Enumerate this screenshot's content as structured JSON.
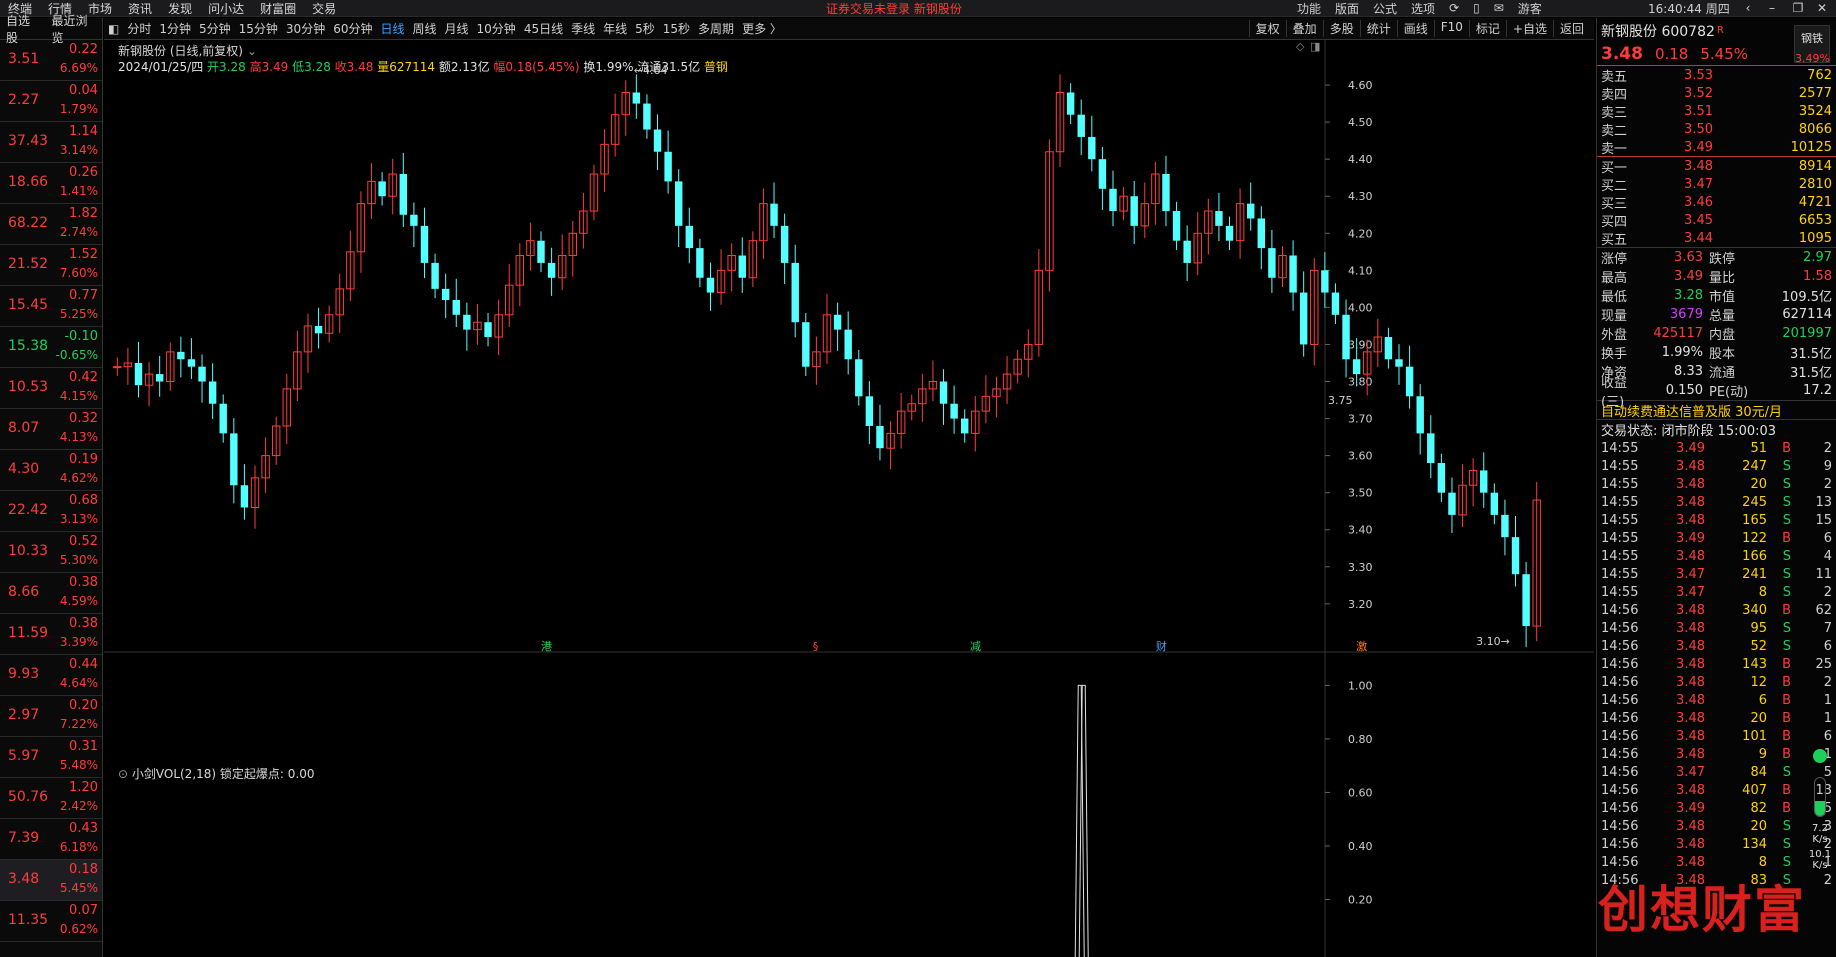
{
  "topbar": {
    "menus": [
      "终端",
      "行情",
      "市场",
      "资讯",
      "发现",
      "问小达",
      "财富圈",
      "交易"
    ],
    "notice": "证券交易未登录  新钢股份",
    "right": [
      "功能",
      "版面",
      "公式",
      "选项"
    ],
    "user": "游客",
    "clock": "16:40:44 周四"
  },
  "watch": {
    "tabs": [
      "自选股",
      "最近浏览"
    ],
    "rows": [
      {
        "price": "3.51",
        "chg": "0.22",
        "pct": "6.69%",
        "c": "up"
      },
      {
        "price": "2.27",
        "chg": "0.04",
        "pct": "1.79%",
        "c": "up"
      },
      {
        "price": "37.43",
        "chg": "1.14",
        "pct": "3.14%",
        "c": "up"
      },
      {
        "price": "18.66",
        "chg": "0.26",
        "pct": "1.41%",
        "c": "up"
      },
      {
        "price": "68.22",
        "chg": "1.82",
        "pct": "2.74%",
        "c": "up"
      },
      {
        "price": "21.52",
        "chg": "1.52",
        "pct": "7.60%",
        "c": "up"
      },
      {
        "price": "15.45",
        "chg": "0.77",
        "pct": "5.25%",
        "c": "up"
      },
      {
        "price": "15.38",
        "chg": "-0.10",
        "pct": "-0.65%",
        "c": "dn"
      },
      {
        "price": "10.53",
        "chg": "0.42",
        "pct": "4.15%",
        "c": "up"
      },
      {
        "price": "8.07",
        "chg": "0.32",
        "pct": "4.13%",
        "c": "up"
      },
      {
        "price": "4.30",
        "chg": "0.19",
        "pct": "4.62%",
        "c": "up"
      },
      {
        "price": "22.42",
        "chg": "0.68",
        "pct": "3.13%",
        "c": "up"
      },
      {
        "price": "10.33",
        "chg": "0.52",
        "pct": "5.30%",
        "c": "up"
      },
      {
        "price": "8.66",
        "chg": "0.38",
        "pct": "4.59%",
        "c": "up"
      },
      {
        "price": "11.59",
        "chg": "0.38",
        "pct": "3.39%",
        "c": "up"
      },
      {
        "price": "9.93",
        "chg": "0.44",
        "pct": "4.64%",
        "c": "up"
      },
      {
        "price": "2.97",
        "chg": "0.20",
        "pct": "7.22%",
        "c": "up"
      },
      {
        "price": "5.97",
        "chg": "0.31",
        "pct": "5.48%",
        "c": "up"
      },
      {
        "price": "50.76",
        "chg": "1.20",
        "pct": "2.42%",
        "c": "up"
      },
      {
        "price": "7.39",
        "chg": "0.43",
        "pct": "6.18%",
        "c": "up"
      },
      {
        "price": "3.48",
        "chg": "0.18",
        "pct": "5.45%",
        "c": "up",
        "sel": true
      },
      {
        "price": "11.35",
        "chg": "0.07",
        "pct": "0.62%",
        "c": "up"
      }
    ]
  },
  "toolbar": {
    "periods": [
      "分时",
      "1分钟",
      "5分钟",
      "15分钟",
      "30分钟",
      "60分钟",
      "日线",
      "周线",
      "月线",
      "10分钟",
      "45日线",
      "季线",
      "年线",
      "5秒",
      "15秒",
      "多周期",
      "更多 〉"
    ],
    "active": "日线",
    "right": [
      "复权",
      "叠加",
      "多股",
      "统计",
      "画线",
      "F10",
      "标记",
      "+自选",
      "返回"
    ]
  },
  "chart": {
    "title": "新钢股份 (日线,前复权)",
    "info": [
      {
        "t": "2024/01/25/四 ",
        "c": "wh"
      },
      {
        "t": "开3.28 ",
        "c": "dn"
      },
      {
        "t": "高3.49 ",
        "c": "up"
      },
      {
        "t": "低3.28 ",
        "c": "dn"
      },
      {
        "t": "收3.48 ",
        "c": "up"
      },
      {
        "t": "量627114 ",
        "c": "yl"
      },
      {
        "t": "额2.13亿 ",
        "c": "wh"
      },
      {
        "t": "幅0.18(5.45%) ",
        "c": "up"
      },
      {
        "t": "换1.99% ",
        "c": "wh"
      },
      {
        "t": "流通31.5亿 ",
        "c": "wh"
      },
      {
        "t": "普钢",
        "c": "yl"
      }
    ],
    "high_label": "4.64",
    "low_label": "3.10",
    "axis_label": "3.75",
    "markers": [
      "港",
      "§",
      "减",
      "财",
      "激"
    ],
    "indicator_title": "小剑VOL(2,18)  锁定起爆点: 0.00"
  },
  "chart_data": {
    "type": "candlestick",
    "y_axis": [
      "4.60",
      "4.50",
      "4.40",
      "4.30",
      "4.20",
      "4.10",
      "4.00",
      "3.90",
      "3.80",
      "3.70",
      "3.60",
      "3.50",
      "3.40",
      "3.30",
      "3.20"
    ],
    "ylim": [
      3.07,
      4.7
    ],
    "indicator_axis": [
      "1.00",
      "0.80",
      "0.60",
      "0.40",
      "0.20"
    ],
    "indicator_ylim": [
      0,
      1.05
    ],
    "closes": [
      3.84,
      3.85,
      3.79,
      3.82,
      3.8,
      3.88,
      3.86,
      3.84,
      3.8,
      3.74,
      3.66,
      3.52,
      3.46,
      3.54,
      3.6,
      3.68,
      3.78,
      3.88,
      3.95,
      3.93,
      3.98,
      4.05,
      4.15,
      4.28,
      4.34,
      4.3,
      4.36,
      4.25,
      4.22,
      4.12,
      4.05,
      4.02,
      3.98,
      3.94,
      3.96,
      3.92,
      3.98,
      4.06,
      4.14,
      4.18,
      4.12,
      4.08,
      4.14,
      4.2,
      4.26,
      4.36,
      4.44,
      4.52,
      4.58,
      4.55,
      4.48,
      4.42,
      4.34,
      4.22,
      4.16,
      4.08,
      4.04,
      4.1,
      4.14,
      4.08,
      4.18,
      4.28,
      4.22,
      4.12,
      3.96,
      3.84,
      3.88,
      3.98,
      3.94,
      3.86,
      3.76,
      3.68,
      3.62,
      3.66,
      3.72,
      3.74,
      3.78,
      3.8,
      3.74,
      3.7,
      3.66,
      3.72,
      3.76,
      3.78,
      3.82,
      3.86,
      3.9,
      4.1,
      4.42,
      4.58,
      4.52,
      4.46,
      4.4,
      4.32,
      4.26,
      4.3,
      4.22,
      4.28,
      4.36,
      4.26,
      4.18,
      4.12,
      4.2,
      4.26,
      4.22,
      4.18,
      4.28,
      4.24,
      4.16,
      4.08,
      4.14,
      4.04,
      3.9,
      4.1,
      4.04,
      3.98,
      3.86,
      3.82,
      3.88,
      3.92,
      3.86,
      3.84,
      3.76,
      3.66,
      3.58,
      3.5,
      3.44,
      3.52,
      3.56,
      3.5,
      3.44,
      3.38,
      3.28,
      3.14,
      3.48
    ],
    "spike_index": 91
  },
  "quote": {
    "name": "新钢股份 600782",
    "badge": "R",
    "last": "3.48",
    "chg": "0.18",
    "pct": "5.45%",
    "sector": "钢铁",
    "sector_pct": "3.49%",
    "asks": [
      {
        "l": "卖五",
        "p": "3.53",
        "v": "762"
      },
      {
        "l": "卖四",
        "p": "3.52",
        "v": "2577"
      },
      {
        "l": "卖三",
        "p": "3.51",
        "v": "3524"
      },
      {
        "l": "卖二",
        "p": "3.50",
        "v": "8066"
      },
      {
        "l": "卖一",
        "p": "3.49",
        "v": "10125"
      }
    ],
    "bids": [
      {
        "l": "买一",
        "p": "3.48",
        "v": "8914"
      },
      {
        "l": "买二",
        "p": "3.47",
        "v": "2810"
      },
      {
        "l": "买三",
        "p": "3.46",
        "v": "4721"
      },
      {
        "l": "买四",
        "p": "3.45",
        "v": "6653"
      },
      {
        "l": "买五",
        "p": "3.44",
        "v": "1095"
      }
    ],
    "stats": [
      {
        "l1": "涨停",
        "v1": "3.63",
        "c1": "up",
        "l2": "跌停",
        "v2": "2.97",
        "c2": "dn"
      },
      {
        "l1": "最高",
        "v1": "3.49",
        "c1": "up",
        "l2": "量比",
        "v2": "1.58",
        "c2": "up"
      },
      {
        "l1": "最低",
        "v1": "3.28",
        "c1": "dn",
        "l2": "市值",
        "v2": "109.5亿",
        "c2": "wh"
      },
      {
        "l1": "现量",
        "v1": "3679",
        "c1": "pu",
        "l2": "总量",
        "v2": "627114",
        "c2": "wh"
      },
      {
        "l1": "外盘",
        "v1": "425117",
        "c1": "up",
        "l2": "内盘",
        "v2": "201997",
        "c2": "dn"
      },
      {
        "l1": "换手",
        "v1": "1.99%",
        "c1": "wh",
        "l2": "股本",
        "v2": "31.5亿",
        "c2": "wh"
      },
      {
        "l1": "净资",
        "v1": "8.33",
        "c1": "wh",
        "l2": "流通",
        "v2": "31.5亿",
        "c2": "wh"
      },
      {
        "l1": "收益(三)",
        "v1": "0.150",
        "c1": "wh",
        "l2": "PE(动)",
        "v2": "17.2",
        "c2": "wh"
      }
    ],
    "banner": "自动续费通达信普及版  30元/月",
    "state": "交易状态: 闭市阶段 15:00:03",
    "ticks": [
      {
        "t": "14:55",
        "p": "3.49",
        "v": "51",
        "s": "B",
        "n": "2"
      },
      {
        "t": "14:55",
        "p": "3.48",
        "v": "247",
        "s": "S",
        "n": "9"
      },
      {
        "t": "14:55",
        "p": "3.48",
        "v": "20",
        "s": "S",
        "n": "2"
      },
      {
        "t": "14:55",
        "p": "3.48",
        "v": "245",
        "s": "S",
        "n": "13"
      },
      {
        "t": "14:55",
        "p": "3.48",
        "v": "165",
        "s": "S",
        "n": "15"
      },
      {
        "t": "14:55",
        "p": "3.49",
        "v": "122",
        "s": "B",
        "n": "6"
      },
      {
        "t": "14:55",
        "p": "3.48",
        "v": "166",
        "s": "S",
        "n": "4"
      },
      {
        "t": "14:55",
        "p": "3.47",
        "v": "241",
        "s": "S",
        "n": "11"
      },
      {
        "t": "14:55",
        "p": "3.47",
        "v": "8",
        "s": "S",
        "n": "2"
      },
      {
        "t": "14:56",
        "p": "3.48",
        "v": "340",
        "s": "B",
        "n": "62"
      },
      {
        "t": "14:56",
        "p": "3.48",
        "v": "95",
        "s": "S",
        "n": "7"
      },
      {
        "t": "14:56",
        "p": "3.48",
        "v": "52",
        "s": "S",
        "n": "6"
      },
      {
        "t": "14:56",
        "p": "3.48",
        "v": "143",
        "s": "B",
        "n": "25"
      },
      {
        "t": "14:56",
        "p": "3.48",
        "v": "12",
        "s": "B",
        "n": "2"
      },
      {
        "t": "14:56",
        "p": "3.48",
        "v": "6",
        "s": "B",
        "n": "1"
      },
      {
        "t": "14:56",
        "p": "3.48",
        "v": "20",
        "s": "B",
        "n": "1"
      },
      {
        "t": "14:56",
        "p": "3.48",
        "v": "101",
        "s": "B",
        "n": "6"
      },
      {
        "t": "14:56",
        "p": "3.48",
        "v": "9",
        "s": "B",
        "n": "1"
      },
      {
        "t": "14:56",
        "p": "3.47",
        "v": "84",
        "s": "S",
        "n": "5"
      },
      {
        "t": "14:56",
        "p": "3.48",
        "v": "407",
        "s": "B",
        "n": "13"
      },
      {
        "t": "14:56",
        "p": "3.49",
        "v": "82",
        "s": "B",
        "n": "5"
      },
      {
        "t": "14:56",
        "p": "3.48",
        "v": "20",
        "s": "S",
        "n": "3"
      },
      {
        "t": "14:56",
        "p": "3.48",
        "v": "134",
        "s": "S",
        "n": "2"
      },
      {
        "t": "14:56",
        "p": "3.48",
        "v": "8",
        "s": "S",
        "n": "1"
      },
      {
        "t": "14:56",
        "p": "3.48",
        "v": "83",
        "s": "S",
        "n": "2"
      }
    ],
    "gauge_up": "7.2 K/s",
    "gauge_dn": "10.1 K/s"
  },
  "watermark": "创想财富",
  "colors": {
    "up": "#ff3c3c",
    "down": "#1ed05a",
    "candle_down": "#54ffff",
    "bg": "#000000",
    "accent": "#3ca0ff"
  }
}
